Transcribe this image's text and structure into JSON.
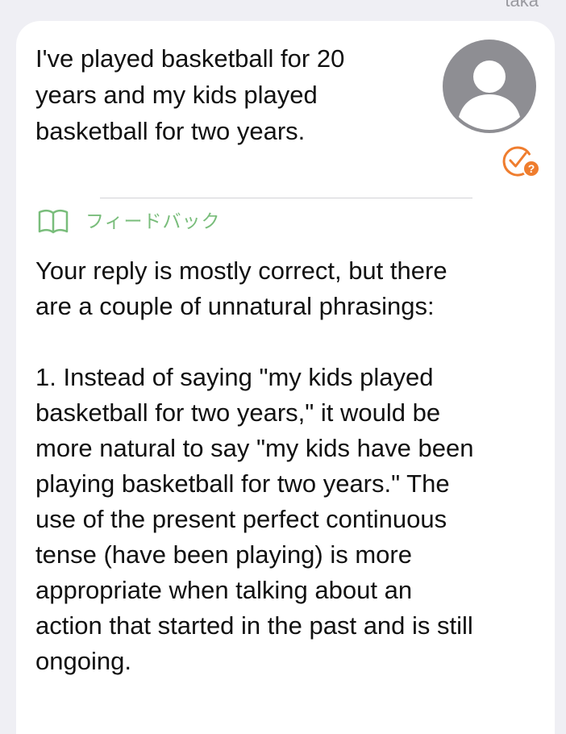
{
  "header": {
    "user_label": "taka"
  },
  "message": {
    "text": "I've played basketball for 20\nyears and my kids played\nbasketball for two years."
  },
  "icons": {
    "avatar": "user-avatar-icon",
    "check": "check-question-icon",
    "feedback": "open-book-icon"
  },
  "colors": {
    "accent_orange": "#EF7D2E",
    "feedback_green": "#79BD7B",
    "avatar_gray": "#8E8E93"
  },
  "feedback": {
    "label": "フィードバック",
    "text": "Your reply is mostly correct, but there\nare a couple of unnatural phrasings:\n\n1. Instead of saying \"my kids played\nbasketball for two years,\" it would be\nmore natural to say \"my kids have been\nplaying basketball for two years.\" The\nuse of the present perfect continuous\ntense (have been playing) is more\nappropriate when talking about an\naction that started in the past and is still\nongoing."
  }
}
